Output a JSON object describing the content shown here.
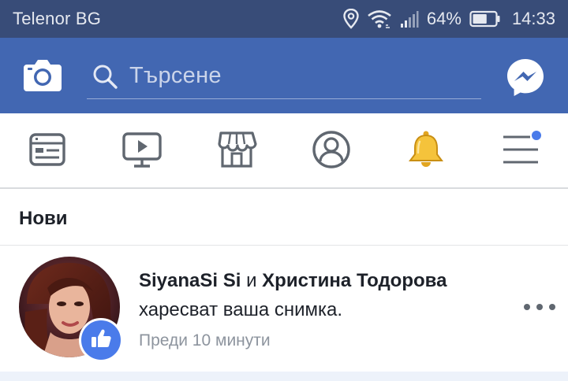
{
  "status_bar": {
    "carrier": "Telenor BG",
    "battery_percent": "64%",
    "battery_level": 0.64,
    "time": "14:33",
    "icons": [
      "location-icon",
      "wifi-icon",
      "signal-icon",
      "battery-icon"
    ]
  },
  "header": {
    "search_placeholder": "Търсене",
    "icons": [
      "camera-icon",
      "search-icon",
      "messenger-icon"
    ]
  },
  "tabs": [
    {
      "name": "news-feed",
      "icon": "news-feed-icon"
    },
    {
      "name": "watch",
      "icon": "video-icon"
    },
    {
      "name": "marketplace",
      "icon": "marketplace-icon"
    },
    {
      "name": "profile",
      "icon": "profile-icon"
    },
    {
      "name": "notifications",
      "icon": "bell-icon",
      "active_color": "#f5c33b"
    },
    {
      "name": "menu",
      "icon": "menu-icon",
      "badge": true
    }
  ],
  "section": {
    "title": "Нови"
  },
  "notifications": [
    {
      "actor1": "SiyanaSi Si",
      "connector": " и ",
      "actor2": "Христина Тодорова",
      "action": "харесват ваша снимка.",
      "time": "Преди 10 минути",
      "reaction_icon": "like-icon"
    }
  ],
  "colors": {
    "status_bar": "#384c78",
    "header": "#4267b2",
    "accent": "#4a7bea",
    "bell": "#f5c33b"
  }
}
